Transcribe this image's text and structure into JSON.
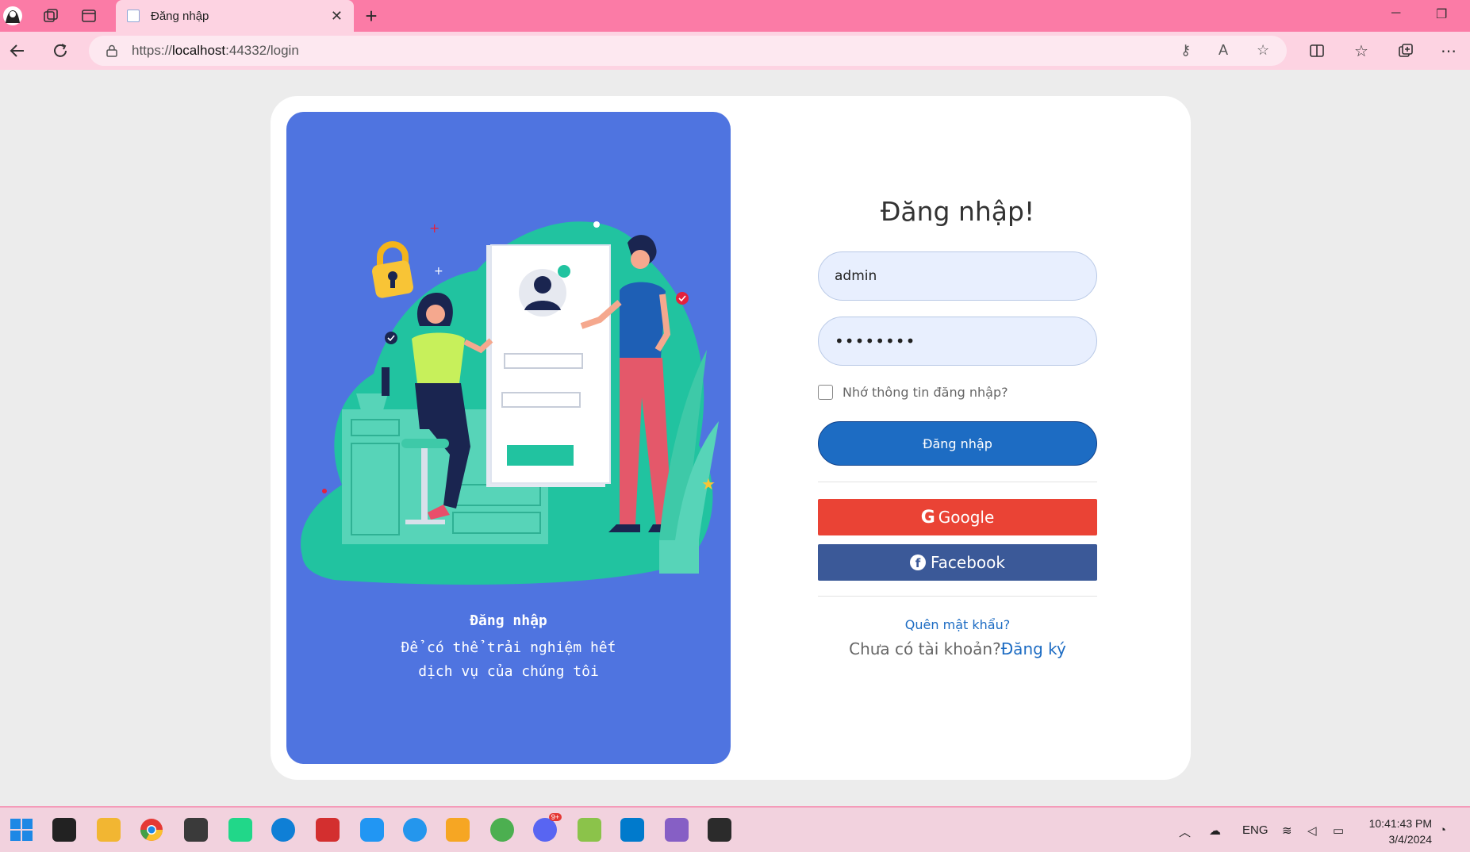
{
  "browser": {
    "tab_title": "Đăng nhập",
    "url_prefix": "https://",
    "url_host": "localhost",
    "url_rest": ":44332/login"
  },
  "illustration": {
    "title": "Đăng nhập",
    "subtitle_line1": "Để có thể trải nghiệm hết",
    "subtitle_line2": "dịch vụ của chúng tôi"
  },
  "form": {
    "title": "Đăng nhập!",
    "username_value": "admin",
    "password_value": "••••••••",
    "remember_label": "Nhớ thông tin đăng nhập?",
    "login_button": "Đăng nhập",
    "google_button": "Google",
    "facebook_button": "Facebook",
    "forgot_password": "Quên mật khẩu?",
    "no_account": "Chưa có tài khoản?",
    "register_link": "Đăng ký"
  },
  "taskbar": {
    "language": "ENG",
    "time": "10:41:43 PM",
    "date": "3/4/2024",
    "discord_badge": "9+"
  },
  "colors": {
    "tabbar": "#fb7ba6",
    "panel": "#4f74e0",
    "primary": "#1d6cc3",
    "google": "#ea4335",
    "facebook": "#3b5998"
  }
}
